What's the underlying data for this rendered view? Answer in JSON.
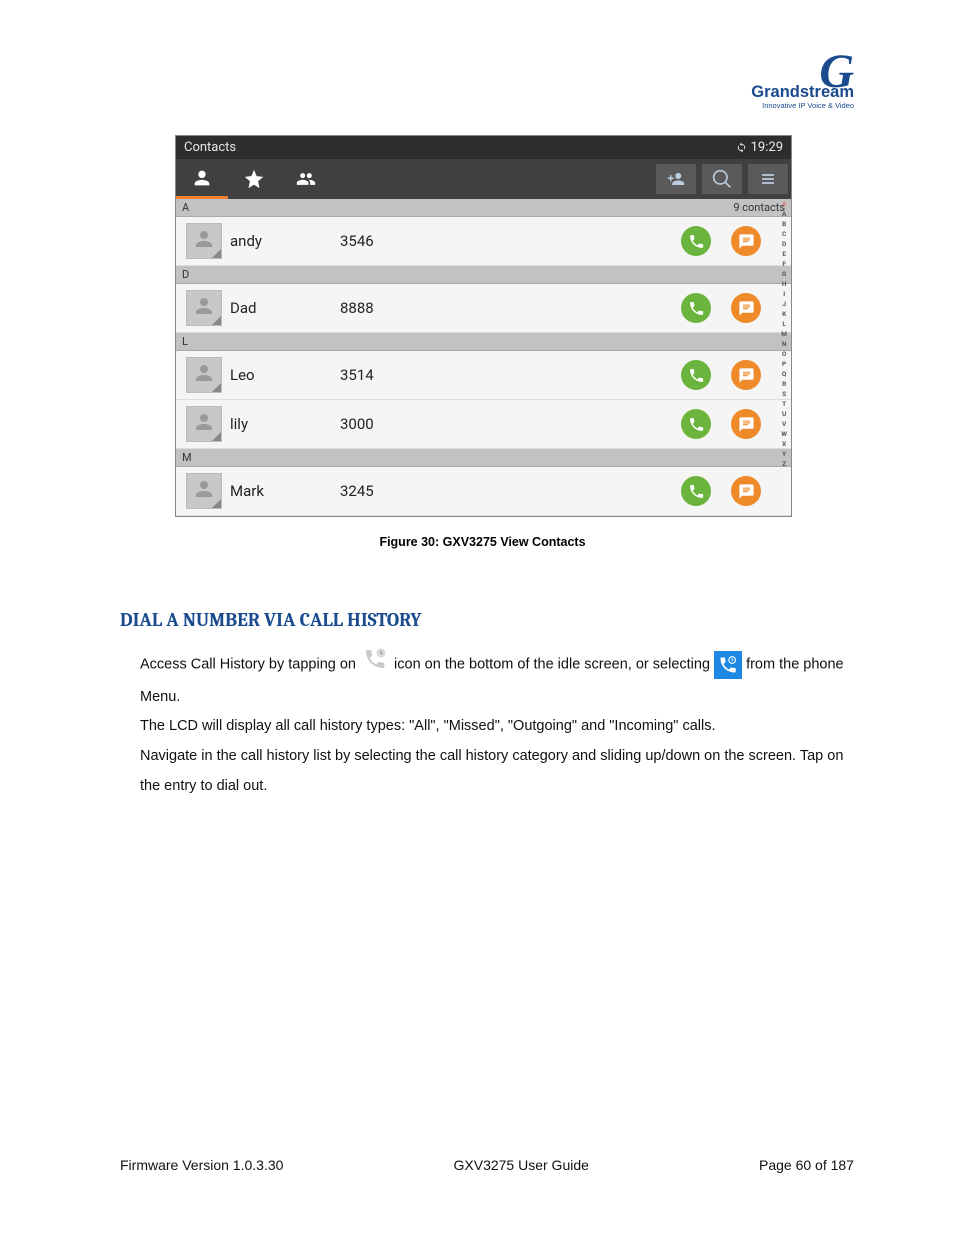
{
  "brand": {
    "name": "Grandstream",
    "tag": "Innovative IP Voice & Video"
  },
  "screenshot": {
    "title": "Contacts",
    "time": "19:29",
    "count": "9 contacts",
    "sections": [
      {
        "letter": "A",
        "showCount": true,
        "rows": [
          {
            "name": "andy",
            "number": "3546"
          }
        ]
      },
      {
        "letter": "D",
        "rows": [
          {
            "name": "Dad",
            "number": "8888"
          }
        ]
      },
      {
        "letter": "L",
        "rows": [
          {
            "name": "Leo",
            "number": "3514"
          },
          {
            "name": "lily",
            "number": "3000"
          }
        ]
      },
      {
        "letter": "M",
        "rows": [
          {
            "name": "Mark",
            "number": "3245"
          }
        ]
      }
    ],
    "alphaIndex": [
      "#",
      "A",
      "B",
      "C",
      "D",
      "E",
      "F",
      "G",
      "H",
      "I",
      "J",
      "K",
      "L",
      "M",
      "N",
      "O",
      "P",
      "Q",
      "R",
      "S",
      "T",
      "U",
      "V",
      "W",
      "X",
      "Y",
      "Z"
    ]
  },
  "figureCaption": "Figure 30: GXV3275 View Contacts",
  "heading": "DIAL A NUMBER VIA CALL HISTORY",
  "body": {
    "p1a": "Access Call History by tapping on ",
    "p1b": " icon on the bottom of the idle screen, or selecting ",
    "p1c": " from the phone Menu.",
    "p2": "The LCD will display all call history types: \"All\", \"Missed\", \"Outgoing\" and \"Incoming\" calls.",
    "p3": "Navigate in the call history list by selecting the call history category and sliding up/down on the screen. Tap on the entry to dial out."
  },
  "footer": {
    "left": "Firmware Version 1.0.3.30",
    "center": "GXV3275 User Guide",
    "right": "Page 60 of 187"
  }
}
